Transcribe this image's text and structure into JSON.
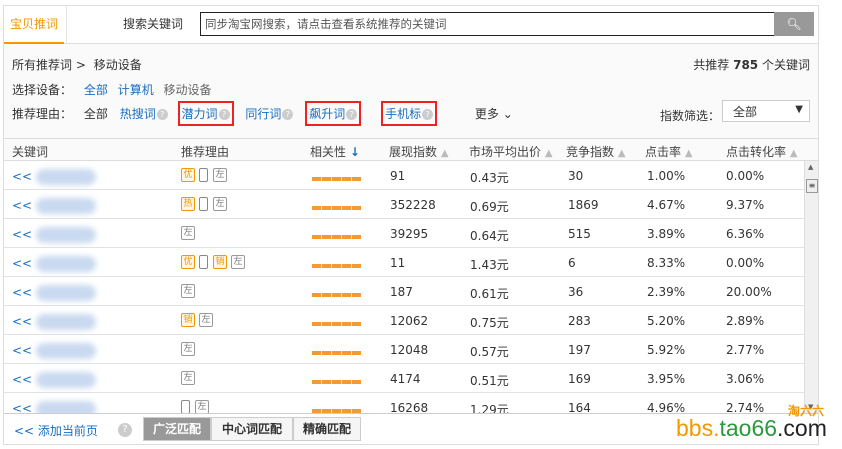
{
  "tabs": [
    "宝贝推词",
    "搜索关键词"
  ],
  "search": {
    "placeholder": "同步淘宝网搜索，请点击查看系统推荐的关键词",
    "icon": "search-icon"
  },
  "breadcrumb": {
    "root": "所有推荐词 >",
    "current": "移动设备"
  },
  "total": {
    "prefix": "共推荐",
    "count": "785",
    "suffix": "个关键词"
  },
  "device": {
    "label": "选择设备：",
    "options": [
      "全部",
      "计算机",
      "移动设备"
    ]
  },
  "reason": {
    "label": "推荐理由：",
    "options": [
      "全部",
      "热搜词",
      "潜力词",
      "同行词",
      "飙升词",
      "手机标"
    ],
    "more": "更多"
  },
  "index_filter": {
    "label": "指数筛选：",
    "value": "全部"
  },
  "columns": [
    "关键词",
    "推荐理由",
    "相关性",
    "展现指数",
    "市场平均出价",
    "竞争指数",
    "点击率",
    "点击转化率"
  ],
  "rows": [
    {
      "add": "<<",
      "tags": [
        "优",
        "phone",
        "左"
      ],
      "exposure": "91",
      "price": "0.43元",
      "competition": "30",
      "ctr": "1.00%",
      "cvr": "0.00%"
    },
    {
      "add": "<<",
      "tags": [
        "热",
        "phone",
        "左"
      ],
      "exposure": "352228",
      "price": "0.69元",
      "competition": "1869",
      "ctr": "4.67%",
      "cvr": "9.37%"
    },
    {
      "add": "<<",
      "tags": [
        "左"
      ],
      "exposure": "39295",
      "price": "0.64元",
      "competition": "515",
      "ctr": "3.89%",
      "cvr": "6.36%"
    },
    {
      "add": "<<",
      "tags": [
        "优",
        "phone",
        "销",
        "左"
      ],
      "exposure": "11",
      "price": "1.43元",
      "competition": "6",
      "ctr": "8.33%",
      "cvr": "0.00%"
    },
    {
      "add": "<<",
      "tags": [
        "左"
      ],
      "exposure": "187",
      "price": "0.61元",
      "competition": "36",
      "ctr": "2.39%",
      "cvr": "20.00%"
    },
    {
      "add": "<<",
      "tags": [
        "销",
        "左"
      ],
      "exposure": "12062",
      "price": "0.75元",
      "competition": "283",
      "ctr": "5.20%",
      "cvr": "2.89%"
    },
    {
      "add": "<<",
      "tags": [
        "左"
      ],
      "exposure": "12048",
      "price": "0.57元",
      "competition": "197",
      "ctr": "5.92%",
      "cvr": "2.77%"
    },
    {
      "add": "<<",
      "tags": [
        "左"
      ],
      "exposure": "4174",
      "price": "0.51元",
      "competition": "169",
      "ctr": "3.95%",
      "cvr": "3.06%"
    },
    {
      "add": "<<",
      "tags": [
        "phone",
        "左"
      ],
      "exposure": "16268",
      "price": "1.29元",
      "competition": "164",
      "ctr": "4.96%",
      "cvr": "2.74%"
    }
  ],
  "footer": {
    "add_page": "<< 添加当前页",
    "match": [
      "广泛匹配",
      "中心词匹配",
      "精确匹配"
    ]
  },
  "watermark": {
    "a": "bbs.",
    "b": "tao66",
    "c": ".com",
    "cn": "淘六六"
  },
  "colors": {
    "accent": "#f39800",
    "link": "#1a6dc1",
    "highlight": "#e22222"
  }
}
